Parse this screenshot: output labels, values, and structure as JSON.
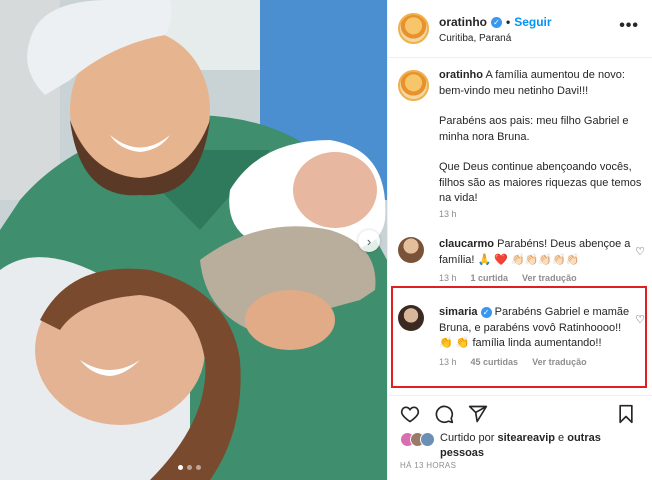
{
  "post": {
    "username": "oratinho",
    "follow_label": "Seguir",
    "dot": "•",
    "location": "Curitiba, Paraná",
    "more_label": "•••"
  },
  "caption": {
    "username": "oratinho",
    "line1": "A família aumentou de novo: bem-vindo meu netinho Davi!!!",
    "line2": "Parabéns aos pais: meu filho Gabriel e minha nora Bruna.",
    "line3": "Que Deus continue abençoando vocês, filhos são as maiores riquezas que temos na vida!",
    "time": "13 h"
  },
  "comments": [
    {
      "username": "claucarmo",
      "text": "Parabéns! Deus abençoe a família! 🙏 ❤️ 👏🏻👏🏻👏🏻👏🏻👏🏻",
      "time": "13 h",
      "likes": "1 curtida",
      "translate": "Ver tradução"
    },
    {
      "username": "simaria",
      "text": "Parabéns Gabriel e mamãe Bruna, e parabéns vovô Ratinhoooo!! 👏 👏 família linda aumentando!!",
      "time": "13 h",
      "likes": "45 curtidas",
      "translate": "Ver tradução"
    }
  ],
  "liked_by": {
    "prefix": "Curtido por",
    "user": "siteareavip",
    "connector": "e",
    "others": "outras pessoas"
  },
  "date": "HÁ 13 HORAS",
  "icons": {
    "verified": "verified-badge-icon",
    "carousel_next": "chevron-right-icon",
    "heart": "heart-icon",
    "comment": "comment-icon",
    "share": "share-icon",
    "save": "bookmark-icon"
  },
  "colors": {
    "follow": "#0095f6",
    "verified": "#3897f0",
    "highlight": "#e02020",
    "scrubs": "#3f8f6e"
  },
  "carousel": {
    "current": 1,
    "total": 3
  }
}
